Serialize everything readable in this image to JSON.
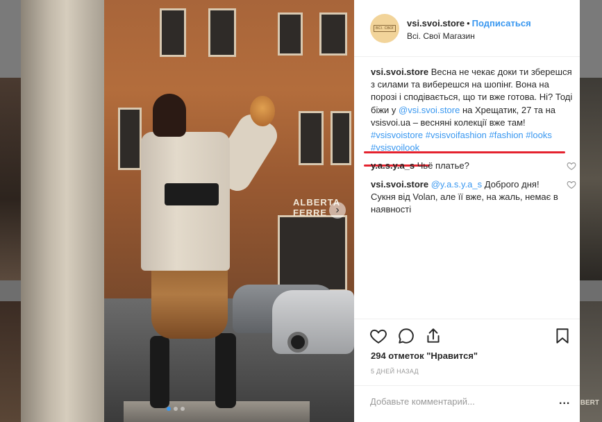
{
  "post": {
    "username": "vsi.svoi.store",
    "follow_label": "Подписаться",
    "location": "Всі. Свої Магазин",
    "avatar_text": "ВСІ. СВОЇ",
    "photo_sign": "ALBERTA FERRE"
  },
  "caption": {
    "username": "vsi.svoi.store",
    "text_part1": "Весна не чекає доки ти зберешся з силами та виберешся на шопінг. Вона на порозі і сподівається, що ти вже готова. Ні? Тоді біжи у ",
    "mention": "@vsi.svoi.store",
    "text_part2": " на Хрещатик, 27 та на vsisvoi.ua – весняні колекції вже там!",
    "hashtags": "#vsisvoistore #vsisvoifashion #fashion #looks #vsisvoilook"
  },
  "comments": [
    {
      "username": "y.a.s.y.a_s",
      "text": "Чьё платье?"
    },
    {
      "username": "vsi.svoi.store",
      "mention": "@y.a.s.y.a_s",
      "text": " Доброго дня! Сукня від Volan, але її вже, на жаль, немає в наявності"
    }
  ],
  "stats": {
    "likes": "294 отметок \"Нравится\"",
    "time": "5 ДНЕЙ НАЗАД"
  },
  "add_comment": {
    "placeholder": "Добавьте комментарий...",
    "more": "..."
  },
  "icons": {
    "like": "heart-icon",
    "comment": "comment-icon",
    "share": "share-icon",
    "save": "bookmark-icon",
    "next": "chevron-right-icon"
  },
  "colors": {
    "link": "#3897f0",
    "annotation": "#e4222e",
    "text": "#262626"
  }
}
